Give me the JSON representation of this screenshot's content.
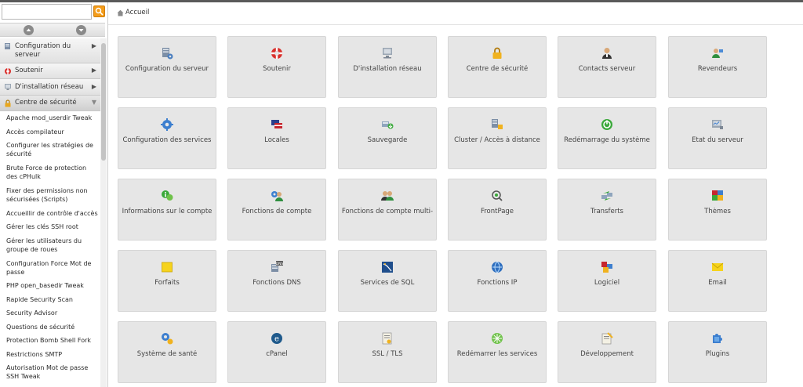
{
  "search": {
    "placeholder": "",
    "button_icon": "search-icon"
  },
  "breadcrumb": {
    "home": "Accueil"
  },
  "sidebar": {
    "categories": [
      {
        "label": "Configuration du serveur",
        "icon": "server-config-icon"
      },
      {
        "label": "Soutenir",
        "icon": "lifebuoy-icon"
      },
      {
        "label": "D'installation réseau",
        "icon": "network-icon"
      },
      {
        "label": "Centre de sécurité",
        "icon": "lock-icon",
        "active": true
      }
    ],
    "subitems": [
      "Apache mod_userdir Tweak",
      "Accès compilateur",
      "Configurer les stratégies de sécurité",
      "Brute Force de protection des cPHulk",
      "Fixer des permissions non sécurisées (Scripts)",
      "Accueillir de contrôle d'accès",
      "Gérer les clés SSH root",
      "Gérer les utilisateurs du groupe de roues",
      "Configuration Force Mot de passe",
      "PHP open_basedir Tweak",
      "Rapide Security Scan",
      "Security Advisor",
      "Questions de sécurité",
      "Protection Bomb Shell Fork",
      "Restrictions SMTP",
      "Autorisation Mot de passe SSH Tweak"
    ]
  },
  "tiles": [
    {
      "label": "Configuration du serveur",
      "icon": "server-config-icon"
    },
    {
      "label": "Soutenir",
      "icon": "lifebuoy-icon"
    },
    {
      "label": "D'installation réseau",
      "icon": "network-icon"
    },
    {
      "label": "Centre de sécurité",
      "icon": "lock-icon"
    },
    {
      "label": "Contacts serveur",
      "icon": "contact-icon"
    },
    {
      "label": "Revendeurs",
      "icon": "resellers-icon"
    },
    {
      "label": "Configuration des services",
      "icon": "gear-icon"
    },
    {
      "label": "Locales",
      "icon": "flag-icon"
    },
    {
      "label": "Sauvegarde",
      "icon": "backup-icon"
    },
    {
      "label": "Cluster / Accès à distance",
      "icon": "cluster-icon"
    },
    {
      "label": "Redémarrage du système",
      "icon": "power-icon"
    },
    {
      "label": "État du serveur",
      "icon": "server-status-icon"
    },
    {
      "label": "Informations sur le compte",
      "icon": "account-info-icon"
    },
    {
      "label": "Fonctions de compte",
      "icon": "account-functions-icon"
    },
    {
      "label": "Fonctions de compte multi-",
      "icon": "multi-account-icon"
    },
    {
      "label": "FrontPage",
      "icon": "frontpage-icon"
    },
    {
      "label": "Transferts",
      "icon": "transfer-icon"
    },
    {
      "label": "Thèmes",
      "icon": "themes-icon"
    },
    {
      "label": "Forfaits",
      "icon": "package-icon"
    },
    {
      "label": "Fonctions DNS",
      "icon": "dns-icon"
    },
    {
      "label": "Services de SQL",
      "icon": "sql-icon"
    },
    {
      "label": "Fonctions IP",
      "icon": "ip-icon"
    },
    {
      "label": "Logiciel",
      "icon": "software-icon"
    },
    {
      "label": "Email",
      "icon": "email-icon"
    },
    {
      "label": "Système de santé",
      "icon": "health-icon"
    },
    {
      "label": "cPanel",
      "icon": "cpanel-icon"
    },
    {
      "label": "SSL / TLS",
      "icon": "ssl-icon"
    },
    {
      "label": "Redémarrer les services",
      "icon": "restart-services-icon"
    },
    {
      "label": "Développement",
      "icon": "development-icon"
    },
    {
      "label": "Plugins",
      "icon": "plugins-icon"
    }
  ],
  "colors": {
    "accent": "#f39c1a",
    "tile_bg": "#e6e6e6",
    "tile_border": "#d6d6d6"
  }
}
